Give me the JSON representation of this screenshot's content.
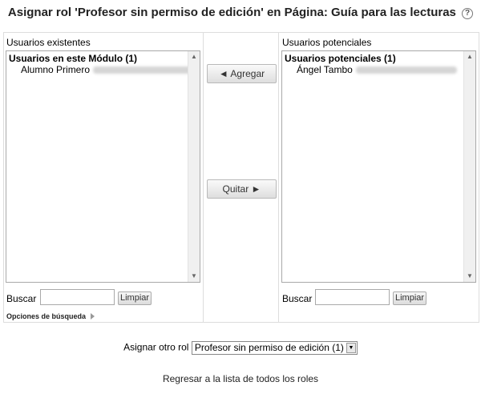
{
  "page": {
    "title": "Asignar rol 'Profesor sin permiso de edición' en Página: Guía para las lecturas",
    "help_icon": "?"
  },
  "existing": {
    "heading": "Usuarios existentes",
    "group": "Usuarios en este Módulo (1)",
    "option_name": "Alumno Primero"
  },
  "potential": {
    "heading": "Usuarios potenciales",
    "group": "Usuarios potenciales (1)",
    "option_name": "Ángel Tambo"
  },
  "actions": {
    "add_label": "◄ Agregar",
    "remove_label": "Quitar ►"
  },
  "search": {
    "label": "Buscar",
    "clear_label": "Limpiar",
    "options_label": "Opciones de búsqueda"
  },
  "other_role": {
    "label": "Asignar otro rol",
    "selected": "Profesor sin permiso de edición (1)"
  },
  "back_link": "Regresar a la lista de todos los roles",
  "icons": {
    "help": "help-icon",
    "scroll_up": "scroll-up-icon",
    "scroll_down": "scroll-down-icon",
    "expand": "expand-arrow-icon",
    "dropdown": "dropdown-arrow-icon"
  }
}
